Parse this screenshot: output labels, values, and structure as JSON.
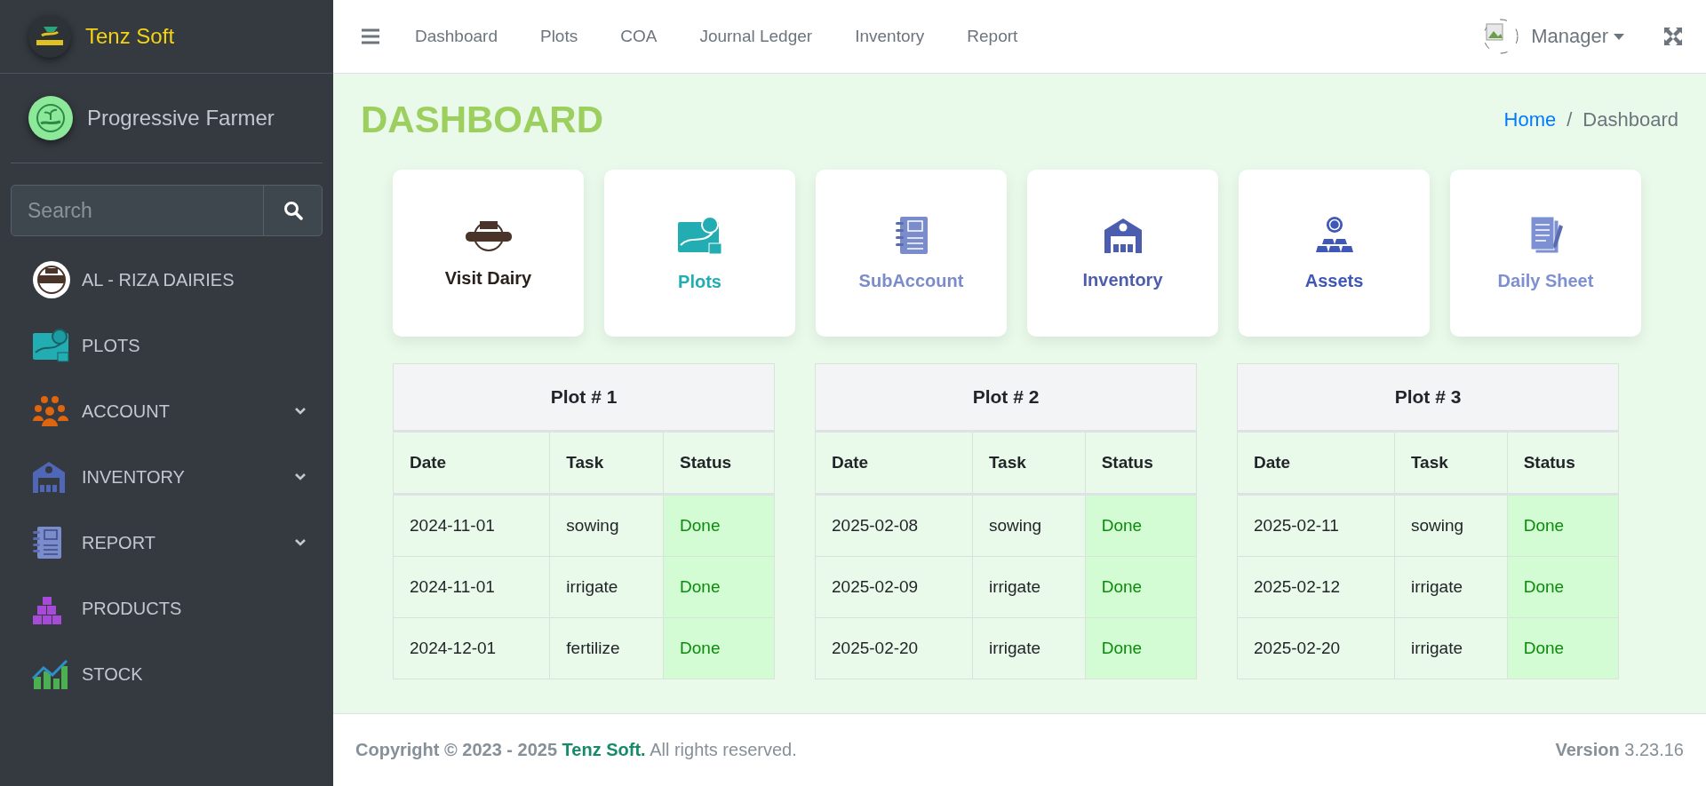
{
  "sidebar": {
    "brand": "Tenz Soft",
    "user": "Progressive Farmer",
    "search": {
      "placeholder": "Search"
    },
    "items": [
      {
        "label": "AL - RIZA DAIRIES",
        "has_submenu": false
      },
      {
        "label": "PLOTS",
        "has_submenu": false
      },
      {
        "label": "ACCOUNT",
        "has_submenu": true
      },
      {
        "label": "INVENTORY",
        "has_submenu": true
      },
      {
        "label": "REPORT",
        "has_submenu": true
      },
      {
        "label": "PRODUCTS",
        "has_submenu": false
      },
      {
        "label": "STOCK",
        "has_submenu": false
      }
    ]
  },
  "topbar": {
    "links": [
      "Dashboard",
      "Plots",
      "COA",
      "Journal Ledger",
      "Inventory",
      "Report"
    ],
    "user": "Manager"
  },
  "page": {
    "title": "DASHBOARD",
    "separator": "/",
    "breadcrumb": [
      {
        "label": "Home",
        "link": true
      },
      {
        "label": "Dashboard",
        "link": false
      }
    ]
  },
  "cards": [
    {
      "label": "Visit Dairy",
      "color": "#2b211c"
    },
    {
      "label": "Plots",
      "color": "#22adb3"
    },
    {
      "label": "SubAccount",
      "color": "#7b8ccc"
    },
    {
      "label": "Inventory",
      "color": "#4c5db0"
    },
    {
      "label": "Assets",
      "color": "#3f57b8"
    },
    {
      "label": "Daily Sheet",
      "color": "#7d90d2"
    }
  ],
  "plots": [
    {
      "title": "Plot # 1",
      "columns": [
        "Date",
        "Task",
        "Status"
      ],
      "rows": [
        [
          "2024-11-01",
          "sowing",
          "Done"
        ],
        [
          "2024-11-01",
          "irrigate",
          "Done"
        ],
        [
          "2024-12-01",
          "fertilize",
          "Done"
        ]
      ]
    },
    {
      "title": "Plot # 2",
      "columns": [
        "Date",
        "Task",
        "Status"
      ],
      "rows": [
        [
          "2025-02-08",
          "sowing",
          "Done"
        ],
        [
          "2025-02-09",
          "irrigate",
          "Done"
        ],
        [
          "2025-02-20",
          "irrigate",
          "Done"
        ]
      ]
    },
    {
      "title": "Plot # 3",
      "columns": [
        "Date",
        "Task",
        "Status"
      ],
      "rows": [
        [
          "2025-02-11",
          "sowing",
          "Done"
        ],
        [
          "2025-02-12",
          "irrigate",
          "Done"
        ],
        [
          "2025-02-20",
          "irrigate",
          "Done"
        ]
      ]
    }
  ],
  "footer": {
    "copyright": "Copyright © 2023 - 2025",
    "company": "Tenz Soft.",
    "rights": "All rights reserved.",
    "version_label": "Version",
    "version": "3.23.16"
  }
}
